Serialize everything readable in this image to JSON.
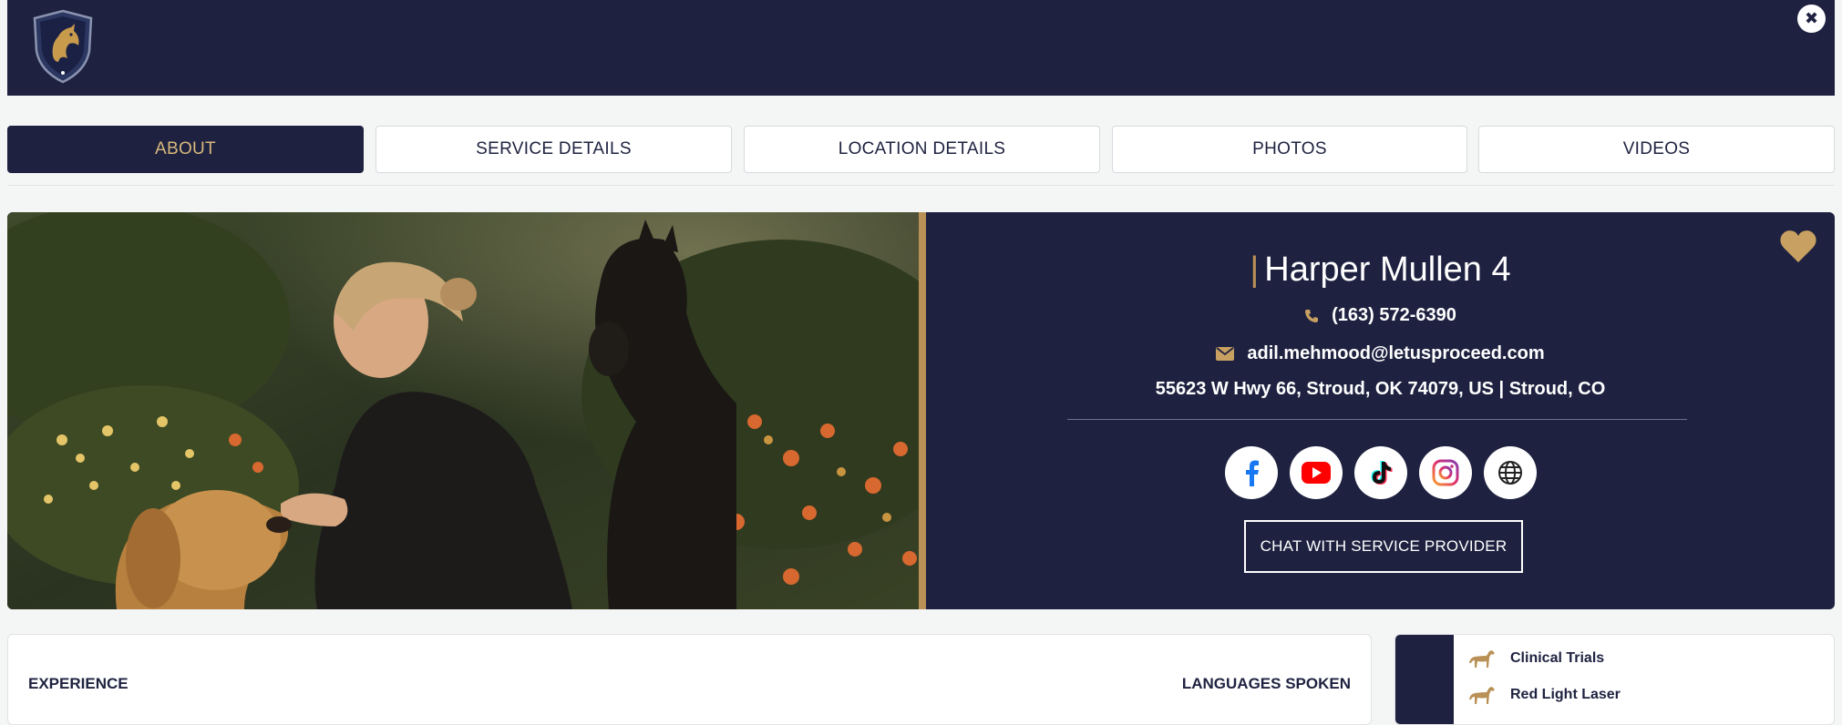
{
  "header": {
    "logo_icon": "horse-shield-logo-icon",
    "close_icon": "close-icon",
    "close_glyph": "✖"
  },
  "tabs": [
    {
      "label": "ABOUT",
      "active": true
    },
    {
      "label": "SERVICE DETAILS",
      "active": false
    },
    {
      "label": "LOCATION DETAILS",
      "active": false
    },
    {
      "label": "PHOTOS",
      "active": false
    },
    {
      "label": "VIDEOS",
      "active": false
    }
  ],
  "profile": {
    "name": "Harper Mullen 4",
    "phone": "(163) 572-6390",
    "email": "adil.mehmood@letusproceed.com",
    "address": "55623 W Hwy 66, Stroud, OK 74079, US | Stroud, CO",
    "chat_button": "CHAT WITH SERVICE PROVIDER",
    "favorite_icon": "heart-icon",
    "socials": [
      "facebook-icon",
      "youtube-icon",
      "tiktok-icon",
      "instagram-icon",
      "globe-icon"
    ]
  },
  "about": {
    "experience_label": "EXPERIENCE",
    "languages_label": "LANGUAGES SPOKEN"
  },
  "services": [
    {
      "label": "Clinical Trials",
      "icon": "horse-icon"
    },
    {
      "label": "Red Light Laser",
      "icon": "horse-icon"
    }
  ],
  "colors": {
    "navy": "#1e2240",
    "gold": "#b99055",
    "tab_active_text": "#d9b97c"
  }
}
